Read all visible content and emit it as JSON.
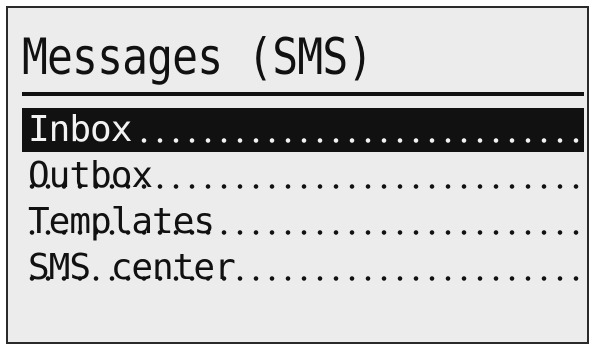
{
  "screen": {
    "title": "Messages (SMS)"
  },
  "menu": {
    "items": [
      {
        "label": "Inbox",
        "selected": true
      },
      {
        "label": "Outbox",
        "selected": false
      },
      {
        "label": "Templates",
        "selected": false
      },
      {
        "label": "SMS center",
        "selected": false
      }
    ]
  },
  "colors": {
    "screen_background": "#ececec",
    "foreground": "#111111",
    "selection_text": "#f2f2f2"
  }
}
